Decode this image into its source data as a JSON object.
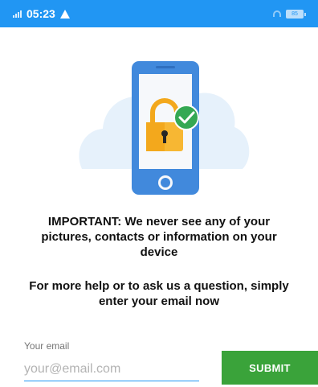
{
  "status_bar": {
    "time": "05:23",
    "battery_label": "85",
    "icons": [
      "signal-icon",
      "warning-icon",
      "wifi-icon",
      "battery-icon"
    ],
    "color": "#2196f3"
  },
  "illustration": {
    "icons": [
      "phone-icon",
      "padlock-icon",
      "check-icon",
      "cloud-icon"
    ]
  },
  "notice": {
    "important": "IMPORTANT: We never see any of your pictures, contacts or information on your device",
    "help": "For more help or to ask us a question, simply enter your email now"
  },
  "form": {
    "email_label": "Your email",
    "email_value": "",
    "email_placeholder": "your@email.com",
    "submit_label": "SUBMIT",
    "submit_color": "#3aa33a"
  }
}
